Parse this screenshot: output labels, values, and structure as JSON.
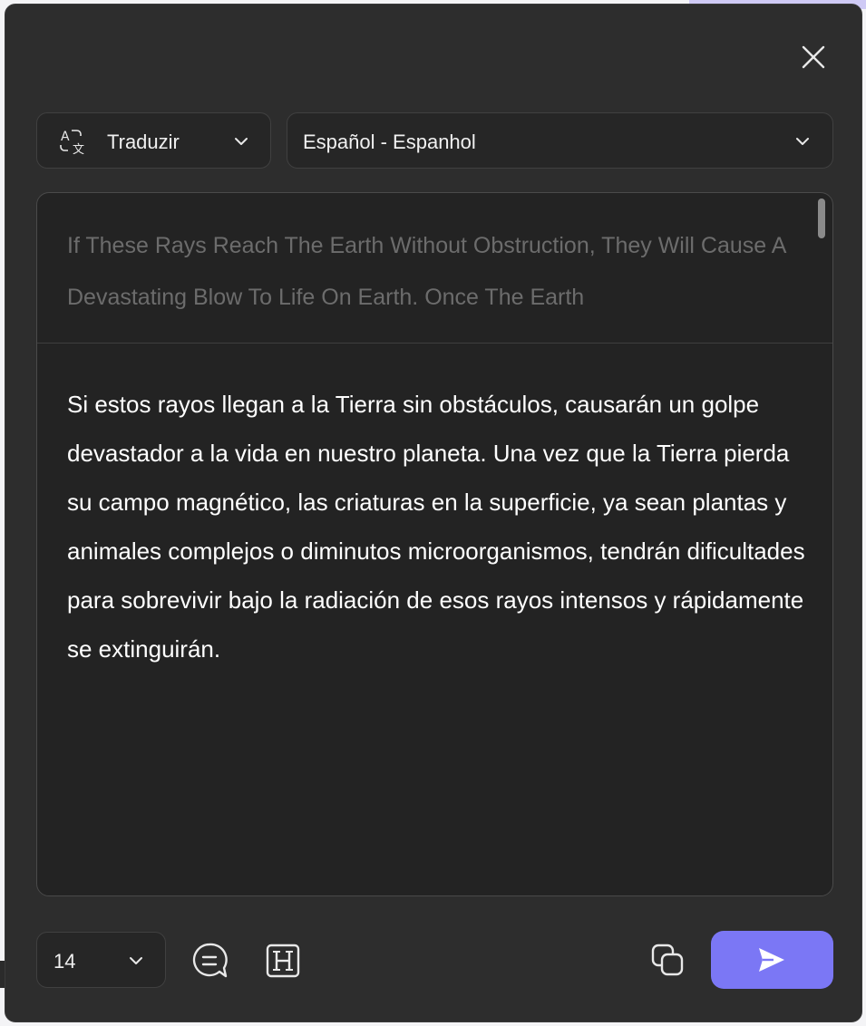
{
  "dialog": {
    "close_icon": "close-icon"
  },
  "mode_dropdown": {
    "icon": "translate-icon",
    "label": "Traduzir"
  },
  "language_dropdown": {
    "label": "Español - Espanhol"
  },
  "source_text": "If These Rays Reach The Earth Without Obstruction, They Will Cause A Devastating Blow To Life On Earth. Once The Earth",
  "translated_text": "Si estos rayos llegan a la Tierra sin obstáculos, causarán un golpe devastador a la vida en nuestro planeta. Una vez que la Tierra pierda su campo magnético, las criaturas en la superficie, ya sean plantas y animales complejos o diminutos microorganismos, tendrán dificultades para sobrevivir bajo la radiación de esos rayos intensos y rápidamente se extinguirán.",
  "toolbar": {
    "font_size": "14",
    "icons": [
      "summarize-icon",
      "heading-icon",
      "copy-icon",
      "send-icon"
    ]
  },
  "colors": {
    "panel_bg": "#2d2d2d",
    "accent": "#7b77f5",
    "source_text": "#6c6c6c",
    "text": "#ffffff"
  }
}
